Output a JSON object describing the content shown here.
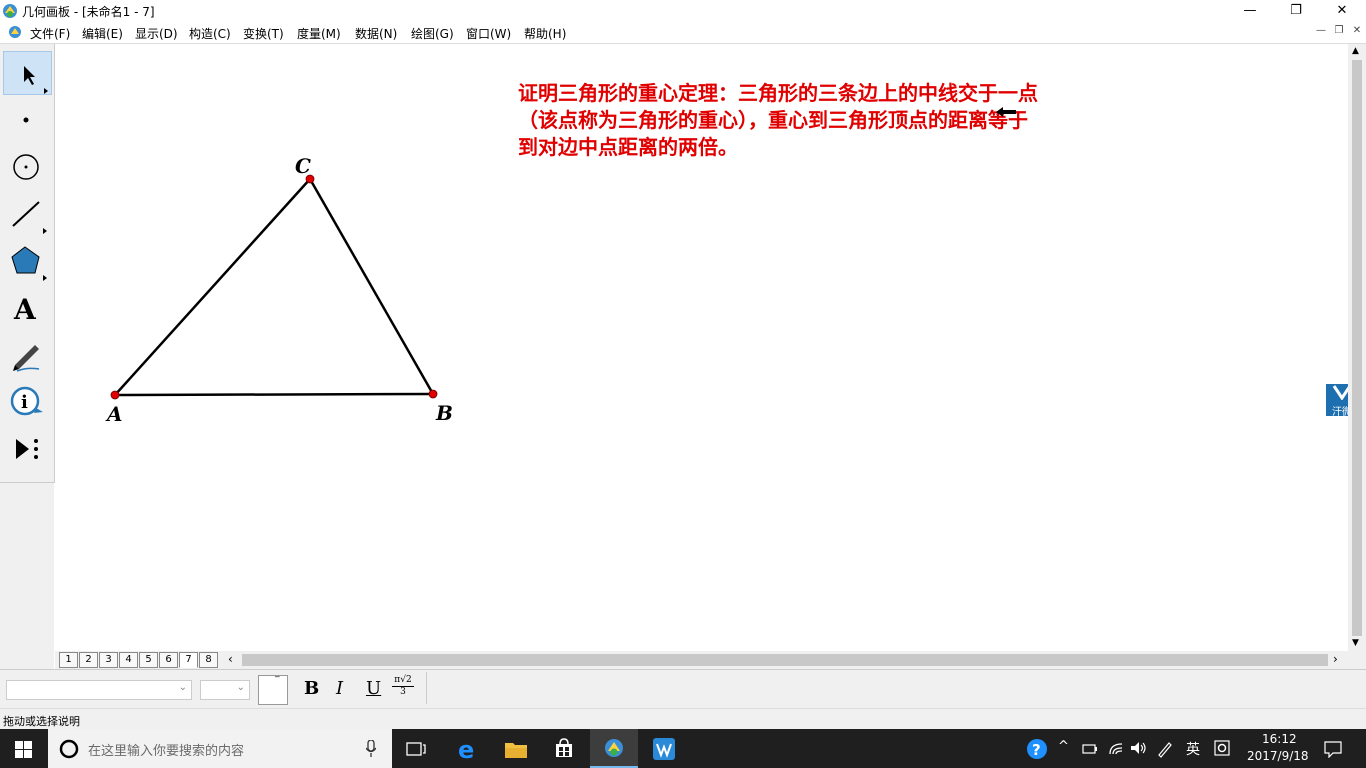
{
  "window": {
    "title": "几何画板 - [未命名1 - 7]",
    "minimize": "—",
    "restore": "❐",
    "close": "✕"
  },
  "menu": {
    "items": [
      "文件(F)",
      "编辑(E)",
      "显示(D)",
      "构造(C)",
      "变换(T)",
      "度量(M)",
      "数据(N)",
      "绘图(G)",
      "窗口(W)",
      "帮助(H)"
    ]
  },
  "canvas": {
    "theorem_text": "证明三角形的重心定理：三角形的三条边上的中线交于一点\n（该点称为三角形的重心），重心到三角形顶点的距离等于\n到对边中点距离的两倍。",
    "vertices": {
      "A": "A",
      "B": "B",
      "C": "C"
    },
    "point_color": "#e00000",
    "text_color": "#e00000"
  },
  "pages": {
    "tabs": [
      "1",
      "2",
      "3",
      "4",
      "5",
      "6",
      "7",
      "8"
    ],
    "active": "7"
  },
  "text_toolbar": {
    "bold": "B",
    "italic": "I",
    "underline": "U",
    "math_num": "π√2",
    "math_den": "3"
  },
  "status": {
    "text": "拖动或选择说明"
  },
  "side_badge": {
    "text": "汗微"
  },
  "taskbar": {
    "search_placeholder": "在这里输入你要搜索的内容",
    "ime": "英",
    "time": "16:12",
    "date": "2017/9/18"
  }
}
